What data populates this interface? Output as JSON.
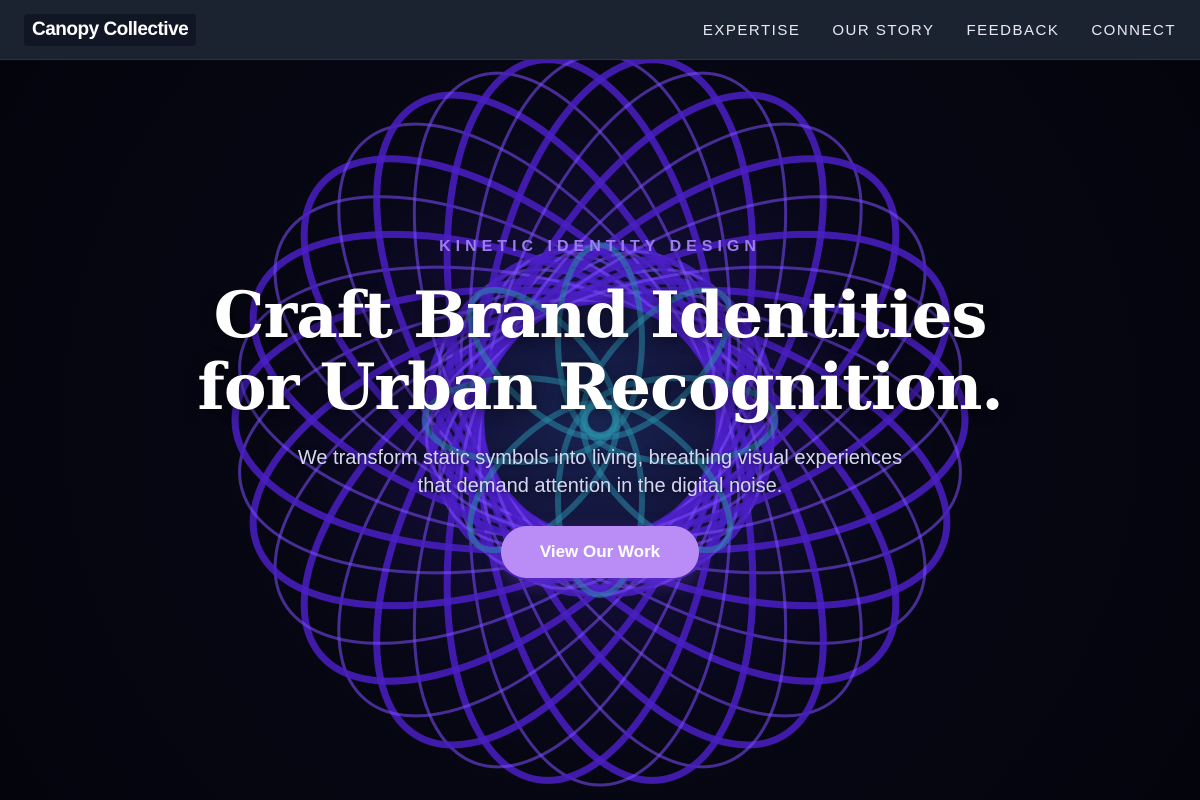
{
  "header": {
    "brand": "Canopy Collective",
    "nav": [
      {
        "label": "EXPERTISE"
      },
      {
        "label": "OUR STORY"
      },
      {
        "label": "FEEDBACK"
      },
      {
        "label": "CONNECT"
      }
    ]
  },
  "hero": {
    "eyebrow": "KINETIC IDENTITY DESIGN",
    "headline": [
      "Craft Brand Identities",
      "for Urban Recognition."
    ],
    "subcopy": [
      "We transform static symbols into living, breathing visual experiences",
      "that demand attention in the digital noise."
    ],
    "cta_label": "View Our Work"
  },
  "art": {
    "icon": "torus-spiral-artwork",
    "colors": {
      "ring": "#4a1fc4",
      "ring_highlight": "#7b4cff",
      "core": "#2a8aa8"
    }
  },
  "colors": {
    "nav_bg": "#1b2230",
    "page_bg": "#05050f",
    "accent": "#b98df5",
    "eyebrow": "#9d7cf0",
    "text": "#ffffff"
  }
}
